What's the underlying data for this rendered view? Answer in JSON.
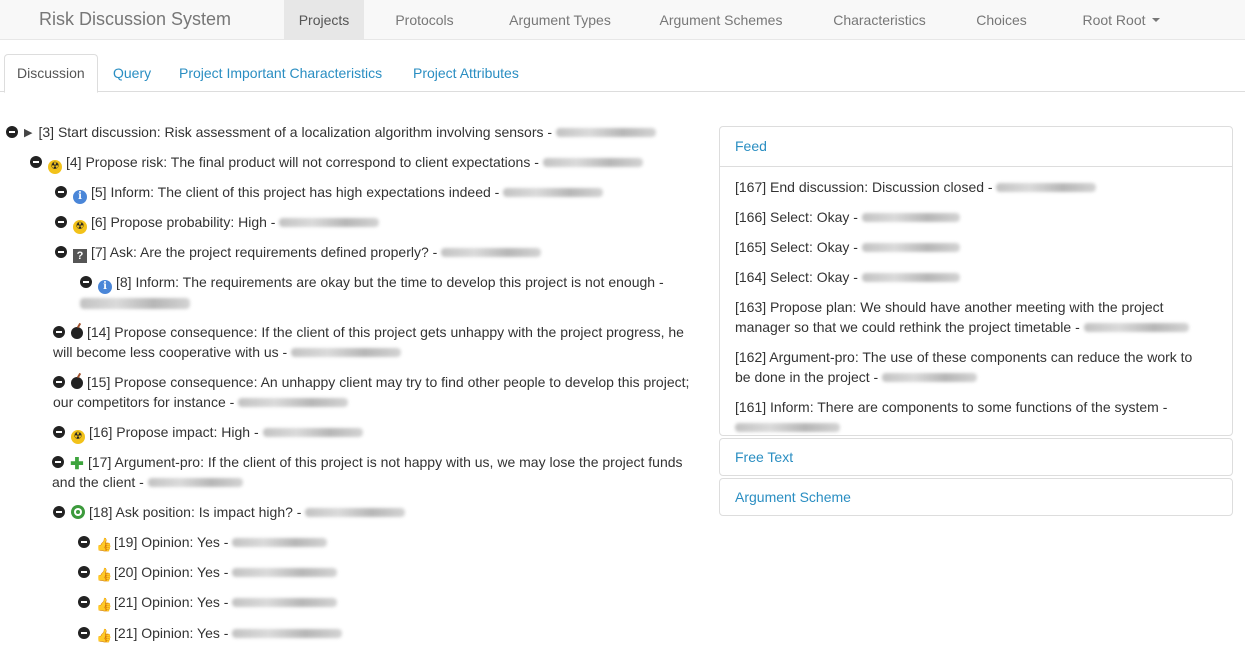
{
  "navbar": {
    "brand": "Risk Discussion System",
    "items": [
      {
        "label": "Projects",
        "active": true
      },
      {
        "label": "Protocols"
      },
      {
        "label": "Argument Types"
      },
      {
        "label": "Argument Schemes"
      },
      {
        "label": "Characteristics"
      },
      {
        "label": "Choices"
      },
      {
        "label": "Root Root",
        "dropdown": true
      }
    ]
  },
  "tabs": [
    {
      "label": "Discussion",
      "active": true
    },
    {
      "label": "Query"
    },
    {
      "label": "Project Important Characteristics"
    },
    {
      "label": "Project Attributes"
    }
  ],
  "tree": [
    {
      "id": "[3]",
      "icon": "play-arrow",
      "text": "Start discussion: Risk assessment of a localization algorithm involving sensors -"
    },
    {
      "id": "[4]",
      "icon": "radiation-icon",
      "text": "Propose risk: The final product will not correspond to client expectations -"
    },
    {
      "id": "[5]",
      "icon": "info-icon",
      "text": "Inform: The client of this project has high expectations indeed -"
    },
    {
      "id": "[6]",
      "icon": "radiation-icon",
      "text": "Propose probability: High -"
    },
    {
      "id": "[7]",
      "icon": "question-icon",
      "text": "Ask: Are the project requirements defined properly? -"
    },
    {
      "id": "[8]",
      "icon": "info-icon",
      "text": "Inform: The requirements are okay but the time to develop this project is not enough -"
    },
    {
      "id": "[14]",
      "icon": "bomb-icon",
      "text": "Propose consequence: If the client of this project gets unhappy with the project progress, he",
      "text2": "will become less cooperative with us -"
    },
    {
      "id": "[15]",
      "icon": "bomb-icon",
      "text": "Propose consequence: An unhappy client may try to find other people to develop this project;",
      "text2": "our competitors for instance -"
    },
    {
      "id": "[16]",
      "icon": "radiation-icon",
      "text": "Propose impact: High -"
    },
    {
      "id": "[17]",
      "icon": "plus-icon",
      "text": "Argument-pro: If the client of this project is not happy with us, we may lose the project funds",
      "text2": "and the client -"
    },
    {
      "id": "[18]",
      "icon": "target-icon",
      "text": "Ask position: Is impact high? -"
    },
    {
      "id": "[19]",
      "icon": "thumbs-up-icon",
      "text": "Opinion: Yes -"
    },
    {
      "id": "[20]",
      "icon": "thumbs-up-icon",
      "text": "Opinion: Yes -"
    },
    {
      "id": "[21]",
      "icon": "thumbs-up-icon",
      "text": "Opinion: Yes -"
    },
    {
      "id": "[21]",
      "icon": "thumbs-up-icon",
      "text": "Opinion: Yes -"
    }
  ],
  "panels": {
    "feed": {
      "title": "Feed",
      "items": [
        {
          "text": "[167] End discussion: Discussion closed -"
        },
        {
          "text": "[166] Select: Okay -"
        },
        {
          "text": "[165] Select: Okay -"
        },
        {
          "text": "[164] Select: Okay -"
        },
        {
          "text": "[163] Propose plan: We should have another meeting with the project",
          "text2": "manager so that we could rethink the project timetable -"
        },
        {
          "text": "[162] Argument-pro: The use of these components can reduce the work to",
          "text2": "be done in the project -"
        },
        {
          "text": "[161] Inform: There are components to some functions of the system -"
        }
      ]
    },
    "free_text": {
      "title": "Free Text"
    },
    "argument_scheme": {
      "title": "Argument Scheme"
    }
  },
  "colors": {
    "link": "#2a8ec2",
    "navbar_bg": "#f8f8f8",
    "active_nav": "#e7e7e7"
  }
}
